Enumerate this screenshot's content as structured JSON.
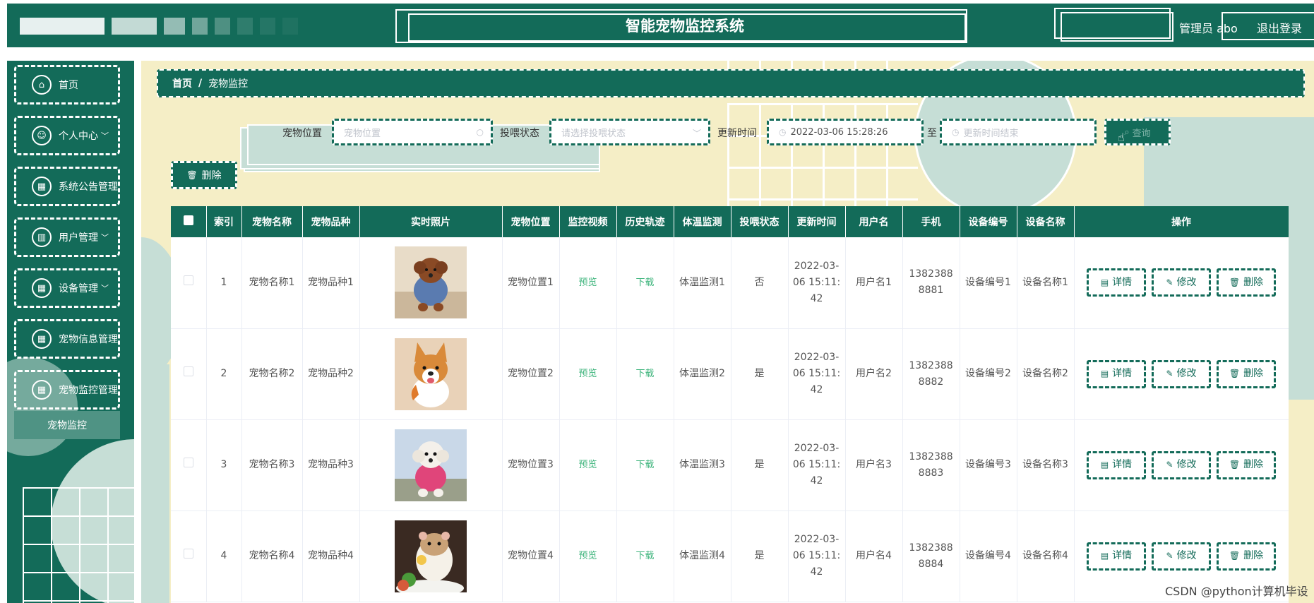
{
  "header": {
    "title": "智能宠物监控系统",
    "admin": "管理员 abo",
    "logout": "退出登录"
  },
  "sidebar": {
    "items": [
      {
        "label": "首页",
        "icon": "home-icon",
        "glyph": "⌂",
        "arrow": ""
      },
      {
        "label": "个人中心",
        "icon": "user-icon",
        "glyph": "☺",
        "arrow": "﹀"
      },
      {
        "label": "系统公告管理",
        "icon": "grid-icon",
        "glyph": "▦",
        "arrow": ""
      },
      {
        "label": "用户管理",
        "icon": "chart-icon",
        "glyph": "▥",
        "arrow": "﹀"
      },
      {
        "label": "设备管理",
        "icon": "grid-icon",
        "glyph": "▦",
        "arrow": "﹀"
      },
      {
        "label": "宠物信息管理",
        "icon": "grid-icon",
        "glyph": "▦",
        "arrow": ""
      },
      {
        "label": "宠物监控管理",
        "icon": "grid-icon",
        "glyph": "▦",
        "arrow": ""
      }
    ],
    "submenu": "宠物监控"
  },
  "breadcrumb": {
    "home": "首页",
    "sep": "/",
    "current": "宠物监控"
  },
  "search": {
    "location_label": "宠物位置",
    "location_placeholder": "宠物位置",
    "feed_label": "投喂状态",
    "feed_placeholder": "请选择投喂状态",
    "time_label": "更新时间",
    "time_start": "2022-03-06 15:28:26",
    "time_to": "至",
    "time_end_placeholder": "更新时间结束",
    "query_button": "查询",
    "delete_button": "删除"
  },
  "table": {
    "headers": [
      "",
      "索引",
      "宠物名称",
      "宠物品种",
      "实时照片",
      "宠物位置",
      "监控视频",
      "历史轨迹",
      "体温监测",
      "投喂状态",
      "更新时间",
      "用户名",
      "手机",
      "设备编号",
      "设备名称",
      "操作"
    ],
    "video_link": "预览",
    "track_link": "下载",
    "actions": {
      "detail": "详情",
      "edit": "修改",
      "delete": "删除"
    },
    "rows": [
      {
        "index": "1",
        "name": "宠物名称1",
        "breed": "宠物品种1",
        "photo": "poodle-brown",
        "location": "宠物位置1",
        "temperature": "体温监测1",
        "feed": "否",
        "time": "2022-03-06 15:11:42",
        "user": "用户名1",
        "phone": "13823888881",
        "device_no": "设备编号1",
        "device_name": "设备名称1"
      },
      {
        "index": "2",
        "name": "宠物名称2",
        "breed": "宠物品种2",
        "photo": "corgi",
        "location": "宠物位置2",
        "temperature": "体温监测2",
        "feed": "是",
        "time": "2022-03-06 15:11:42",
        "user": "用户名2",
        "phone": "13823888882",
        "device_no": "设备编号2",
        "device_name": "设备名称2"
      },
      {
        "index": "3",
        "name": "宠物名称3",
        "breed": "宠物品种3",
        "photo": "poodle-white",
        "location": "宠物位置3",
        "temperature": "体温监测3",
        "feed": "是",
        "time": "2022-03-06 15:11:42",
        "user": "用户名3",
        "phone": "13823888883",
        "device_no": "设备编号3",
        "device_name": "设备名称3"
      },
      {
        "index": "4",
        "name": "宠物名称4",
        "breed": "宠物品种4",
        "photo": "hamster",
        "location": "宠物位置4",
        "temperature": "体温监测4",
        "feed": "是",
        "time": "2022-03-06 15:11:42",
        "user": "用户名4",
        "phone": "13823888884",
        "device_no": "设备编号4",
        "device_name": "设备名称4"
      }
    ]
  },
  "watermark": "CSDN @python计算机毕设",
  "colors": {
    "primary": "#136b59",
    "accent_bg": "#f5eec6",
    "mint": "#c6ded6",
    "link": "#3bb37a"
  }
}
